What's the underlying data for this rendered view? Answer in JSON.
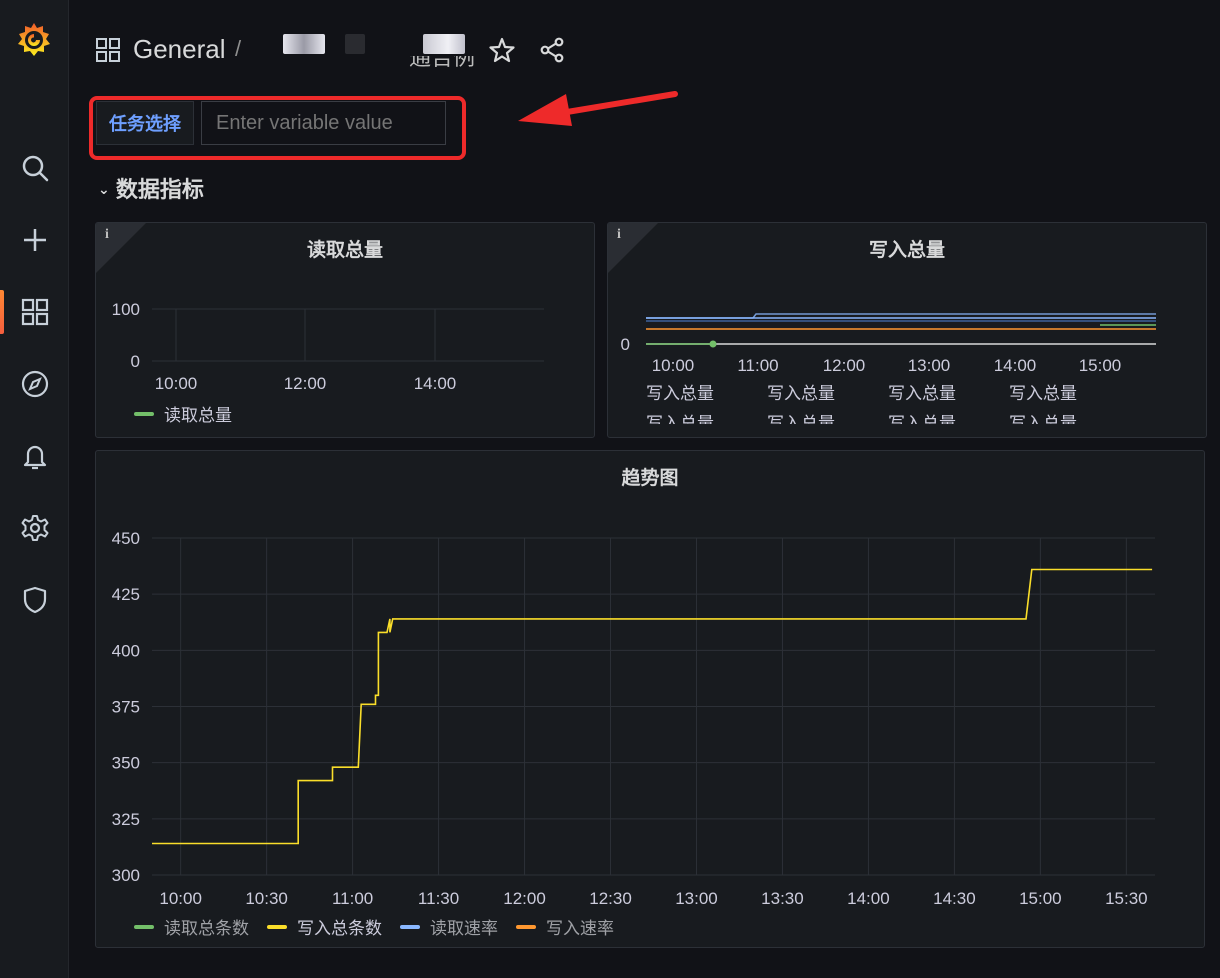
{
  "header": {
    "title": "General",
    "separator": "/",
    "cut_text": "通告例"
  },
  "variable": {
    "label": "任务选择",
    "placeholder": "Enter variable value"
  },
  "row": {
    "title": "数据指标"
  },
  "panels": {
    "read_total": {
      "title": "读取总量",
      "info": "i",
      "legend": [
        {
          "name": "读取总量",
          "color": "#73bf69"
        }
      ]
    },
    "write_total": {
      "title": "写入总量",
      "info": "i",
      "legend": [
        {
          "name": "写入总量",
          "color": "#73bf69"
        },
        {
          "name": "写入总量",
          "color": "#fade2a"
        },
        {
          "name": "写入总量",
          "color": "#8ab8ff"
        },
        {
          "name": "写入总量",
          "color": "#ff9830"
        },
        {
          "name": "写入总量",
          "color": "#f2495c"
        },
        {
          "name": "写入总量",
          "color": "#5794f2"
        },
        {
          "name": "写入总量",
          "color": "#b877d9"
        },
        {
          "name": "写入总量",
          "color": "#705da0"
        }
      ]
    },
    "trend": {
      "title": "趋势图",
      "legend": [
        {
          "name": "读取总条数",
          "color": "#73bf69"
        },
        {
          "name": "写入总条数",
          "color": "#fade2a"
        },
        {
          "name": "读取速率",
          "color": "#8ab8ff"
        },
        {
          "name": "写入速率",
          "color": "#ff9830"
        }
      ]
    }
  },
  "chart_data": [
    {
      "type": "line",
      "title": "读取总量",
      "x_ticks": [
        "10:00",
        "12:00",
        "14:00"
      ],
      "y_ticks": [
        "0",
        "100"
      ],
      "ylim": [
        0,
        100
      ],
      "series": [
        {
          "name": "读取总量",
          "values": []
        }
      ]
    },
    {
      "type": "line",
      "title": "写入总量",
      "x_ticks": [
        "10:00",
        "11:00",
        "12:00",
        "13:00",
        "14:00",
        "15:00"
      ],
      "y_ticks": [
        "0"
      ],
      "series": []
    },
    {
      "type": "line",
      "title": "趋势图",
      "x_ticks": [
        "10:00",
        "10:30",
        "11:00",
        "11:30",
        "12:00",
        "12:30",
        "13:00",
        "13:30",
        "14:00",
        "14:30",
        "15:00",
        "15:30"
      ],
      "y_ticks": [
        "300",
        "325",
        "350",
        "375",
        "400",
        "425",
        "450"
      ],
      "ylim": [
        300,
        450
      ],
      "series": [
        {
          "name": "写入总条数",
          "color": "#fade2a",
          "points": [
            [
              "09:50",
              314
            ],
            [
              "10:41",
              314
            ],
            [
              "10:41",
              342
            ],
            [
              "10:53",
              342
            ],
            [
              "10:53",
              348
            ],
            [
              "11:02",
              348
            ],
            [
              "11:03",
              376
            ],
            [
              "11:08",
              376
            ],
            [
              "11:08",
              380
            ],
            [
              "11:09",
              380
            ],
            [
              "11:09",
              408
            ],
            [
              "11:12",
              408
            ],
            [
              "11:13",
              414
            ],
            [
              "11:13",
              408
            ],
            [
              "11:14",
              414
            ],
            [
              "14:55",
              414
            ],
            [
              "14:57",
              436
            ],
            [
              "15:39",
              436
            ]
          ]
        }
      ]
    }
  ]
}
